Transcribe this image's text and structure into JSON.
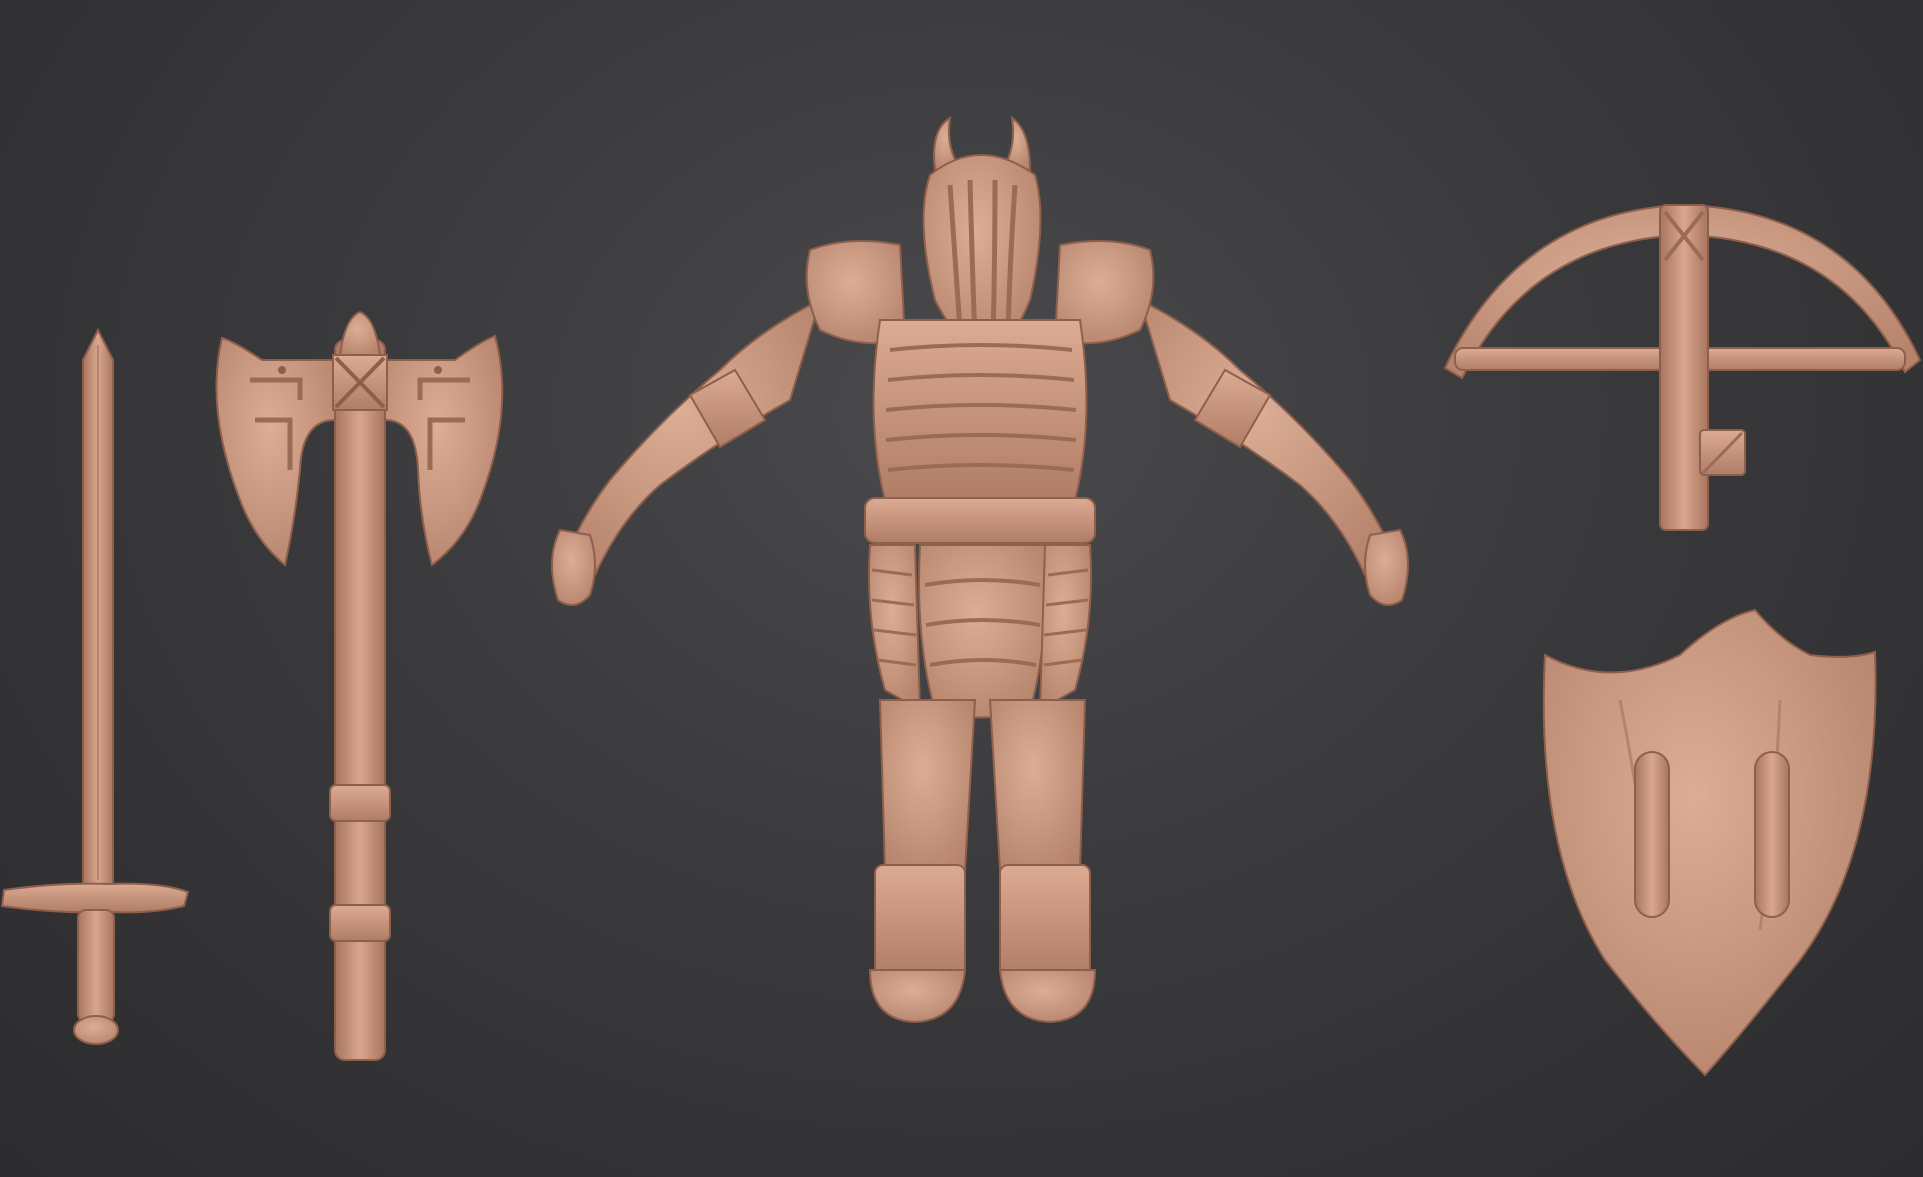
{
  "scene": {
    "background_color": "#3b3b3d",
    "clay_color": "#c9937a",
    "clay_shadow": "#9b6b55",
    "clay_highlight": "#e0b09a"
  },
  "objects": [
    {
      "id": "sword",
      "kind": "sword"
    },
    {
      "id": "double-axe",
      "kind": "axe"
    },
    {
      "id": "armored-warrior",
      "kind": "character"
    },
    {
      "id": "crossbow",
      "kind": "crossbow"
    },
    {
      "id": "heater-shield",
      "kind": "shield"
    }
  ]
}
